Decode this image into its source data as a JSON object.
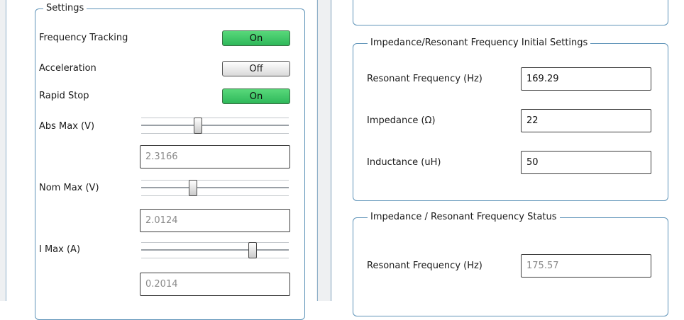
{
  "settings": {
    "legend": "Settings",
    "frequency_tracking": {
      "label": "Frequency Tracking",
      "state": "On"
    },
    "acceleration": {
      "label": "Acceleration",
      "state": "Off"
    },
    "rapid_stop": {
      "label": "Rapid Stop",
      "state": "On"
    },
    "abs_max": {
      "label": "Abs Max (V)",
      "value": "2.3166",
      "level": 0.38
    },
    "nom_max": {
      "label": "Nom Max (V)",
      "value": "2.0124",
      "level": 0.34
    },
    "i_max": {
      "label": "I Max (A)",
      "value": "0.2014",
      "level": 0.77
    }
  },
  "initial_settings": {
    "legend": "Impedance/Resonant Frequency Initial Settings",
    "resonant_frequency": {
      "label": "Resonant Frequency (Hz)",
      "value": "169.29"
    },
    "impedance": {
      "label": "Impedance (Ω)",
      "value": "22"
    },
    "inductance": {
      "label": "Inductance (uH)",
      "value": "50"
    }
  },
  "status": {
    "legend": "Impedance / Resonant Frequency Status",
    "resonant_frequency": {
      "label": "Resonant Frequency (Hz)",
      "value": "175.57"
    }
  },
  "colors": {
    "on": "#2fb85a",
    "off": "#e6e6e6",
    "group_border": "#5e93b8"
  }
}
